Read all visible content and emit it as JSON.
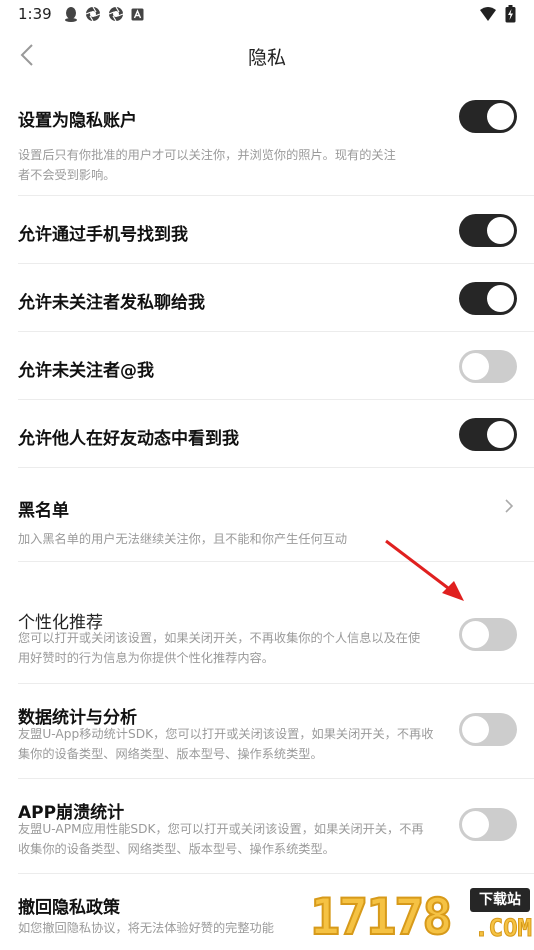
{
  "status_bar": {
    "time": "1:39",
    "left_icons": [
      "qq-penguin-icon",
      "aperture-icon",
      "aperture-icon",
      "app-a-icon"
    ],
    "right_icons": [
      "wifi-icon",
      "battery-charging-icon"
    ]
  },
  "nav": {
    "title": "隐私",
    "back_icon": "chevron-left-icon"
  },
  "settings": [
    {
      "title": "设置为隐私账户",
      "desc_lines": [
        "设置后只有你批准的用户才可以关注你，并浏览你的照片。现有的关注",
        "者不会受到影响。"
      ],
      "control": "toggle",
      "on": true
    },
    {
      "title": "允许通过手机号找到我",
      "desc_lines": [],
      "control": "toggle",
      "on": true
    },
    {
      "title": "允许未关注者发私聊给我",
      "desc_lines": [],
      "control": "toggle",
      "on": true
    },
    {
      "title": "允许未关注者@我",
      "desc_lines": [],
      "control": "toggle",
      "on": false
    },
    {
      "title": "允许他人在好友动态中看到我",
      "desc_lines": [],
      "control": "toggle",
      "on": true
    },
    {
      "title": "黑名单",
      "desc_lines": [
        "加入黑名单的用户无法继续关注你，且不能和你产生任何互动"
      ],
      "control": "chevron"
    },
    {
      "title": "个性化推荐",
      "desc_lines": [
        "您可以打开或关闭该设置，如果关闭开关，不再收集你的个人信息以及在使",
        "用好赞时的行为信息为你提供个性化推荐内容。"
      ],
      "control": "toggle",
      "on": false
    },
    {
      "title": "数据统计与分析",
      "desc_lines": [
        "友盟U-App移动统计SDK，您可以打开或关闭该设置，如果关闭开关，不再收",
        "集你的设备类型、网络类型、版本型号、操作系统类型。"
      ],
      "control": "toggle",
      "on": false
    },
    {
      "title": "APP崩溃统计",
      "desc_lines": [
        "友盟U-APM应用性能SDK，您可以打开或关闭该设置，如果关闭开关，不再",
        "收集你的设备类型、网络类型、版本型号、操作系统类型。"
      ],
      "control": "toggle",
      "on": false
    },
    {
      "title": "撤回隐私政策",
      "desc_lines": [
        "如您撤回隐私协议，将无法体验好赞的完整功能"
      ],
      "control": "none"
    }
  ],
  "watermark": {
    "digits": "17178",
    "badge": "下载站",
    "suffix": ".COM"
  },
  "colors": {
    "toggle_on": "#262626",
    "toggle_off": "#cdcdcd",
    "annotation_arrow": "#e0201f",
    "watermark_gold": "#f5c243"
  }
}
